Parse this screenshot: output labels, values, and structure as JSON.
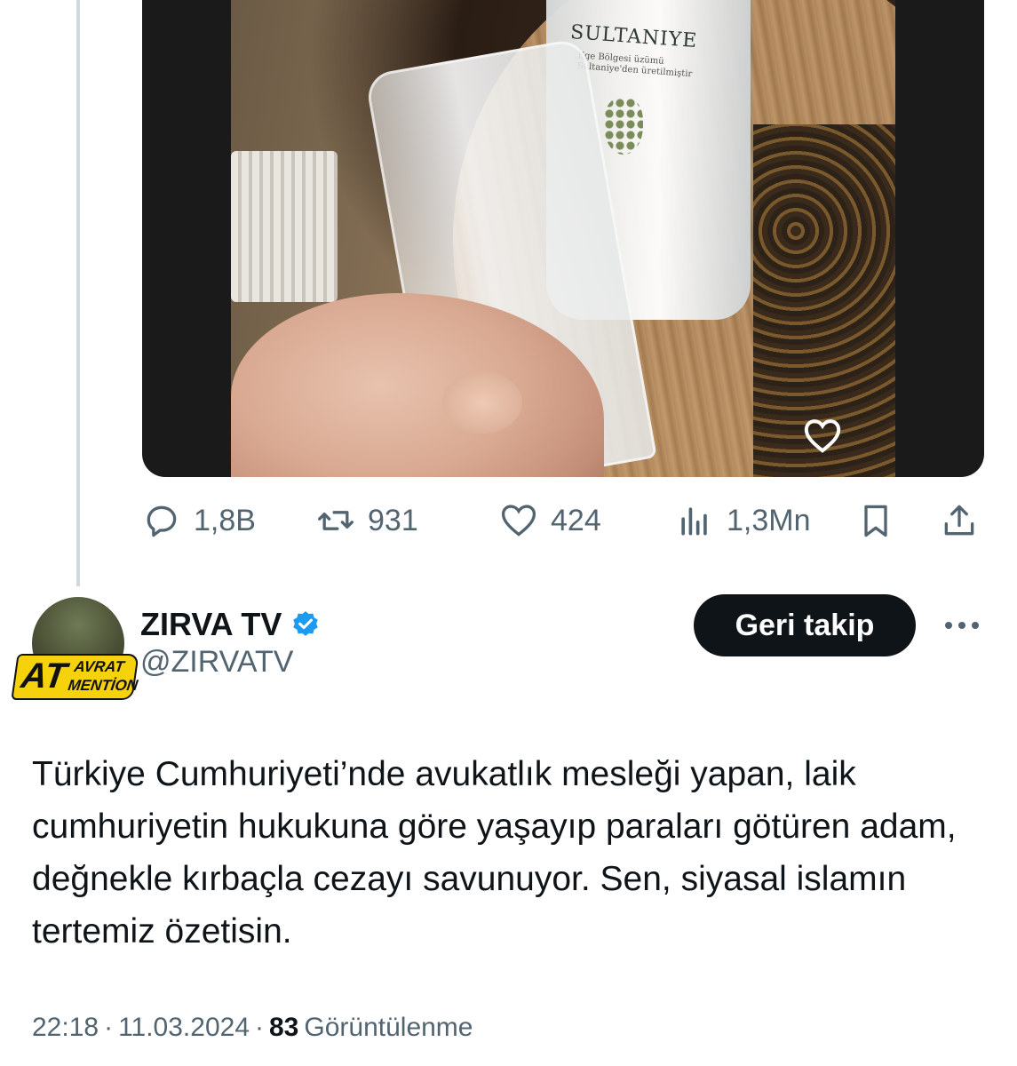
{
  "media": {
    "bottle_label": "SULTANIYE",
    "bottle_sub": "Ege Bölgesi üzümü Sultaniye'den üretilmiştir"
  },
  "actions": {
    "replies": "1,8B",
    "retweets": "931",
    "likes": "424",
    "views": "1,3Mn"
  },
  "author": {
    "name": "ZIRVA TV",
    "handle": "@ZIRVATV",
    "verified": true,
    "badge_big": "AT",
    "badge_top": "AVRAT",
    "badge_bottom": "MENTİON"
  },
  "follow_button": "Geri takip",
  "tweet_text": "Türkiye Cumhuriyeti’nde avukatlık mesleği yapan, laik cumhuriyetin hukukuna göre yaşayıp paraları götüren adam, değnekle kırbaçla cezayı savunuyor. Sen, siyasal islamın tertemiz özetisin.",
  "meta": {
    "time": "22:18",
    "date": "11.03.2024",
    "sep": "·",
    "views_count": "83",
    "views_label": "Görüntülenme"
  },
  "colors": {
    "text": "#0f1419",
    "secondary": "#536471",
    "verified": "#1d9bf0",
    "badge": "#f5d20b"
  }
}
